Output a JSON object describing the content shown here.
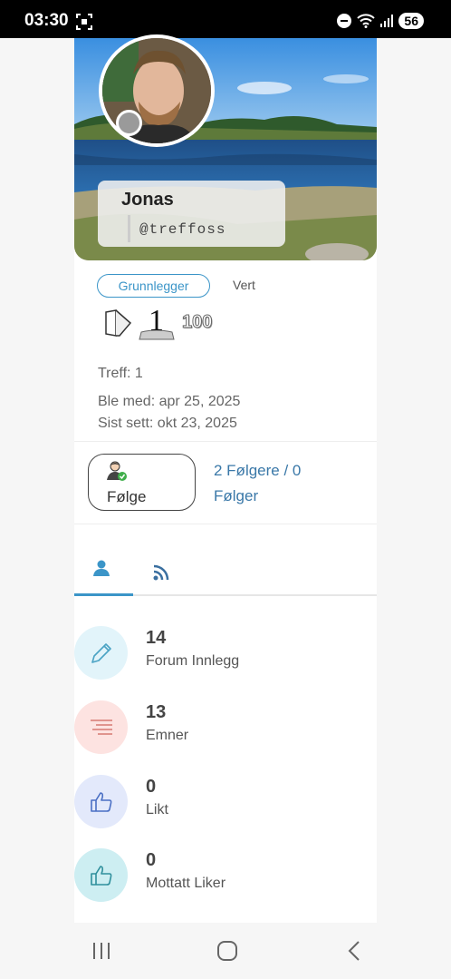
{
  "status_bar": {
    "time": "03:30",
    "battery": "56"
  },
  "profile": {
    "name": "Jonas",
    "handle": "@treffoss",
    "badges": [
      "Grunnlegger",
      "Vert"
    ],
    "rank_number": "1",
    "score": "100",
    "hits": "Treff: 1",
    "joined": "Ble med: apr 25, 2025",
    "last_seen": "Sist sett: okt 23, 2025"
  },
  "follow": {
    "button_label": "Følge",
    "followers_text": "2 Følgere / 0 Følger"
  },
  "tabs": [
    {
      "icon": "user-icon"
    },
    {
      "icon": "rss-icon"
    }
  ],
  "stats": [
    {
      "value": "14",
      "label": "Forum Innlegg",
      "icon": "pencil-icon",
      "color": "#e2f4fa"
    },
    {
      "value": "13",
      "label": "Emner",
      "icon": "lines-icon",
      "color": "#fde3e1"
    },
    {
      "value": "0",
      "label": "Likt",
      "icon": "thumbs-up-icon",
      "color": "#e3e9fb"
    },
    {
      "value": "0",
      "label": "Mottatt Liker",
      "icon": "thumbs-up-received-icon",
      "color": "#cdeef2"
    }
  ]
}
